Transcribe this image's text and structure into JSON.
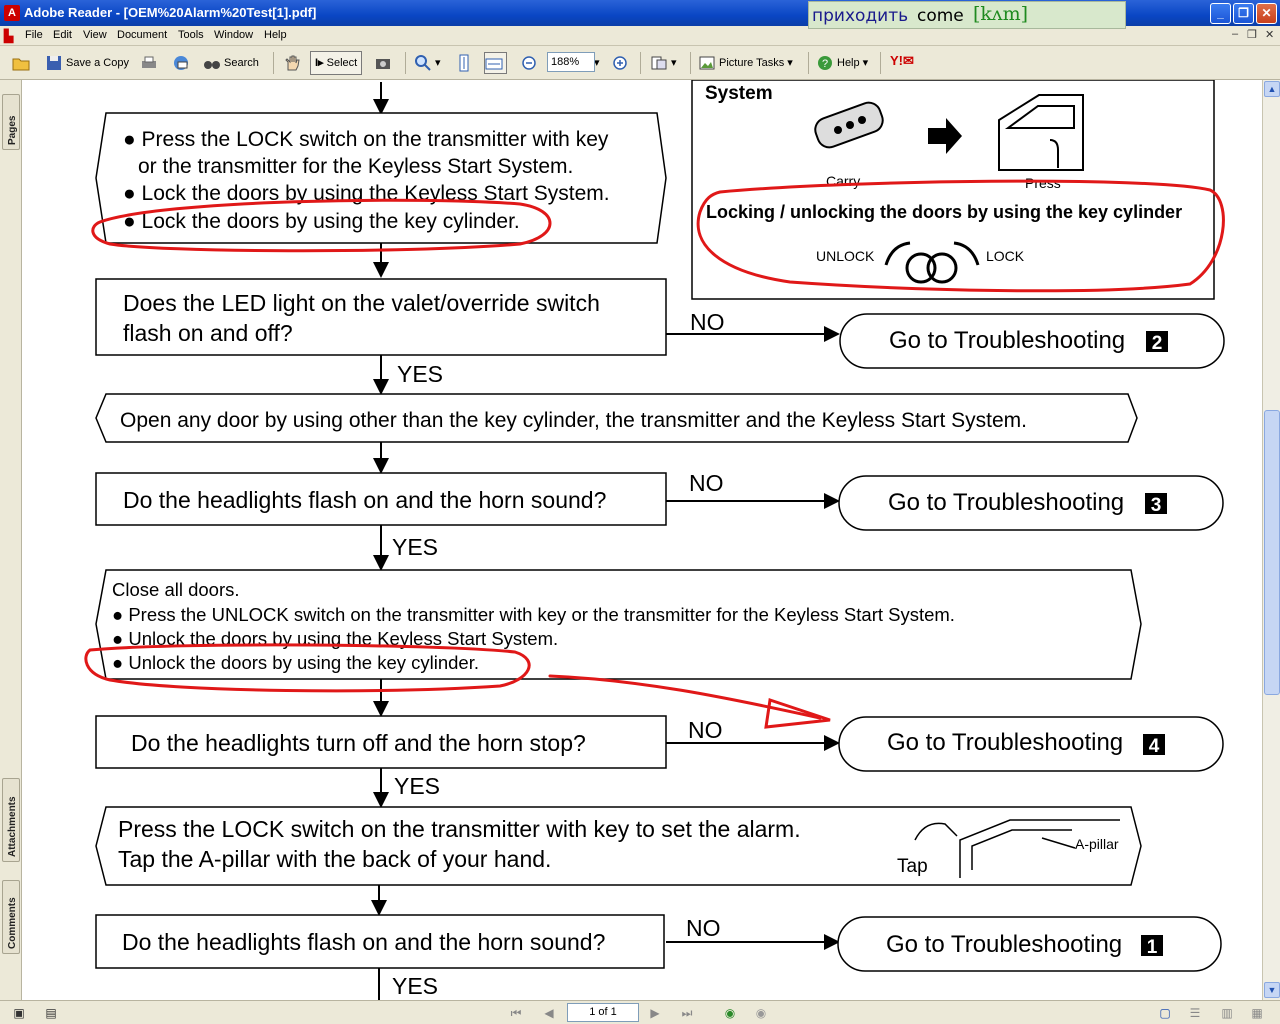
{
  "window": {
    "title": "Adobe Reader - [OEM%20Alarm%20Test[1].pdf]"
  },
  "dictionary_popup": {
    "russian": "приходить",
    "english": "come",
    "ipa": "[kʌm]"
  },
  "menu": [
    "File",
    "Edit",
    "View",
    "Document",
    "Tools",
    "Window",
    "Help"
  ],
  "toolbar": {
    "save_copy": "Save a Copy",
    "search": "Search",
    "select": "Select",
    "zoom_value": "188%",
    "picture_tasks": "Picture Tasks",
    "help": "Help"
  },
  "left_tabs": [
    "Pages",
    "Attachments",
    "Comments"
  ],
  "status": {
    "page_indicator": "1 of 1"
  },
  "document": {
    "step_lock_bullets": [
      "Press the LOCK switch on the transmitter with key",
      "or the transmitter for the Keyless Start System.",
      "Lock the doors by using the Keyless Start System.",
      "Lock the doors by using the key cylinder."
    ],
    "q_led": [
      "Does the LED light on the valet/override switch",
      "flash on and off?"
    ],
    "open_door": "Open any door by using other than the key cylinder, the transmitter and the Keyless Start System.",
    "q_headlights_flash": "Do the headlights flash on and the horn sound?",
    "close_block": [
      "Close all doors.",
      "Press the UNLOCK switch on the transmitter with key or the transmitter for the Keyless Start System.",
      "Unlock the doors by using the Keyless Start System.",
      "Unlock the doors by using the key cylinder."
    ],
    "q_headlights_off": "Do the headlights turn off and the horn stop?",
    "press_lock_alarm": [
      "Press the LOCK switch on the transmitter with key to set the alarm.",
      "Tap the A-pillar with the back of your hand."
    ],
    "q_headlights_flash_2": "Do the headlights flash on and the horn sound?",
    "yes_label": "YES",
    "no_label": "NO",
    "troubleshoot_label": "Go to Troubleshooting",
    "troubleshoot_numbers": [
      "2",
      "3",
      "4",
      "1"
    ],
    "side_box": {
      "heading": "System",
      "carry": "Carry",
      "press": "Press",
      "locking_heading": "Locking / unlocking the doors by using the key cylinder",
      "unlock": "UNLOCK",
      "lock": "LOCK"
    },
    "tap_label": "Tap",
    "apillar_label": "A-pillar"
  },
  "colors": {
    "annotation_red": "#e01818",
    "title_bar_blue": "#0a46c4"
  }
}
